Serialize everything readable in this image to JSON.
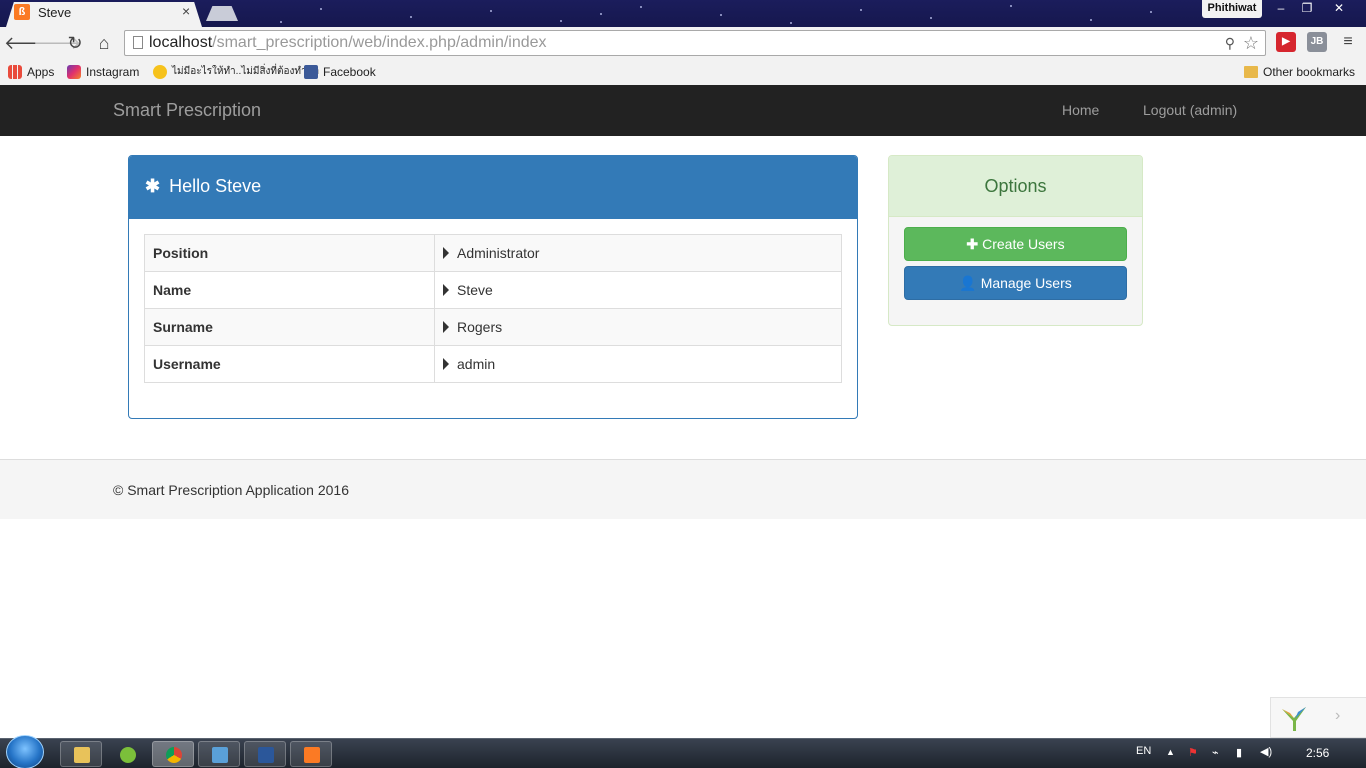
{
  "browser": {
    "tab_title": "Steve",
    "tab_close": "×",
    "profile_name": "Phithiwat",
    "window_controls": {
      "minimize": "–",
      "restore": "❐",
      "close": "✕"
    },
    "url_host": "localhost",
    "url_path": "/smart_prescription/web/index.php/admin/index",
    "extension_icons": [
      "pdf-extension-icon",
      "jb-extension-icon",
      "menu-icon"
    ],
    "ext_jb_label": "JB",
    "bookmarks": {
      "apps": "Apps",
      "instagram": "Instagram",
      "thai": "ไม่มีอะไรให้ทำ..ไม่มีสิ่งที่ต้องทำต่อ",
      "facebook": "Facebook",
      "other": "Other bookmarks"
    }
  },
  "navbar": {
    "brand": "Smart Prescription",
    "home": "Home",
    "logout": "Logout (admin)"
  },
  "profile_panel": {
    "heading": "Hello Steve",
    "rows": [
      {
        "key": "Position",
        "value": "Administrator"
      },
      {
        "key": "Name",
        "value": "Steve"
      },
      {
        "key": "Surname",
        "value": "Rogers"
      },
      {
        "key": "Username",
        "value": "admin"
      }
    ]
  },
  "options_panel": {
    "heading": "Options",
    "create_users": "Create Users",
    "manage_users": "Manage Users"
  },
  "footer": {
    "text": "© Smart Prescription Application 2016"
  },
  "taskbar": {
    "language": "EN",
    "time": "2:56"
  },
  "colors": {
    "primary": "#337ab7",
    "success": "#5cb85c",
    "navbar": "#222222",
    "options_header": "#dff0d8"
  }
}
